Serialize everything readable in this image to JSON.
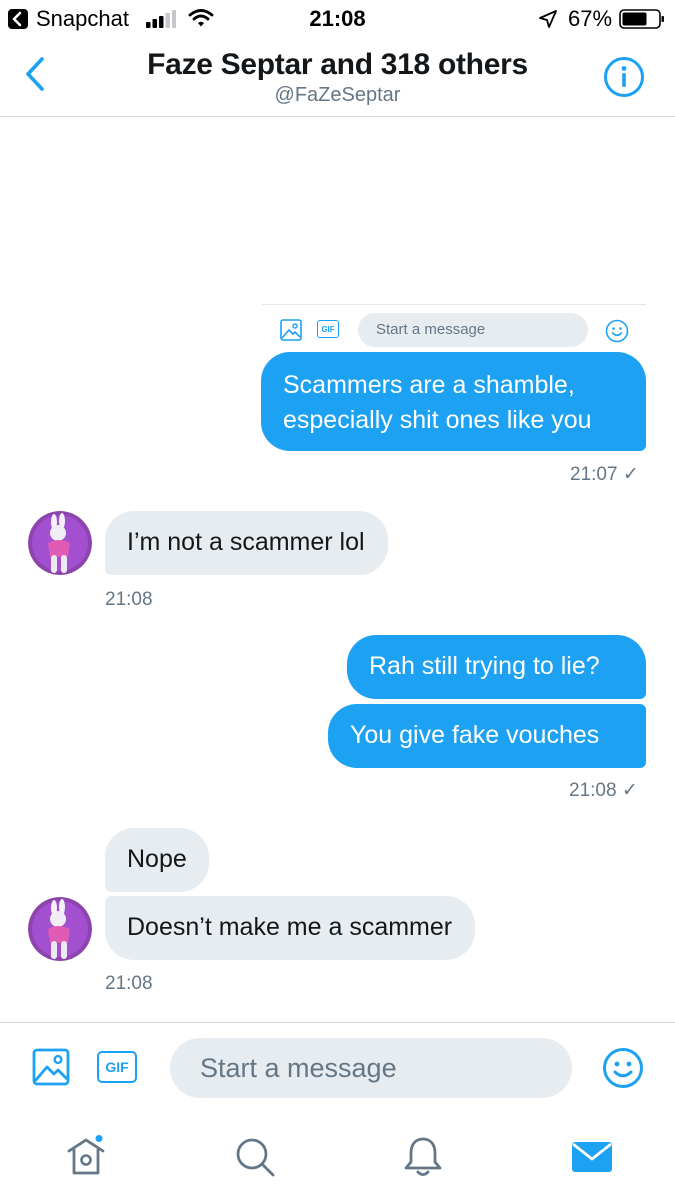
{
  "status_bar": {
    "app_name": "Snapchat",
    "time": "21:08",
    "battery": "67%"
  },
  "header": {
    "title": "Faze Septar and 318 others",
    "handle": "@FaZeSeptar"
  },
  "embedded_composer": {
    "gif_label": "GIF",
    "placeholder": "Start a message"
  },
  "messages": [
    {
      "direction": "outgoing",
      "lines": [
        "Scammers are a shamble,",
        "especially shit ones like you"
      ]
    },
    {
      "direction": "outgoing",
      "timestamp": "21:07 ✓"
    },
    {
      "direction": "incoming",
      "text": "I’m not a scammer lol",
      "timestamp": "21:08"
    },
    {
      "direction": "outgoing",
      "text": "Rah still trying to lie?"
    },
    {
      "direction": "outgoing",
      "text": "You give fake vouches",
      "timestamp": "21:08 ✓"
    },
    {
      "direction": "incoming",
      "text": "Nope"
    },
    {
      "direction": "incoming",
      "text": "Doesn’t make me a scammer",
      "timestamp": "21:08"
    }
  ],
  "composer": {
    "gif_label": "GIF",
    "placeholder": "Start a message"
  },
  "colors": {
    "accent": "#1da1f2",
    "incoming_bubble": "#e6ecf0",
    "secondary_text": "#657786"
  },
  "icons": {
    "back": "chevron-left-icon",
    "info": "info-icon",
    "image": "image-icon",
    "emoji": "smiley-icon",
    "tabs": [
      "home-icon",
      "search-icon",
      "bell-icon",
      "mail-icon"
    ]
  }
}
